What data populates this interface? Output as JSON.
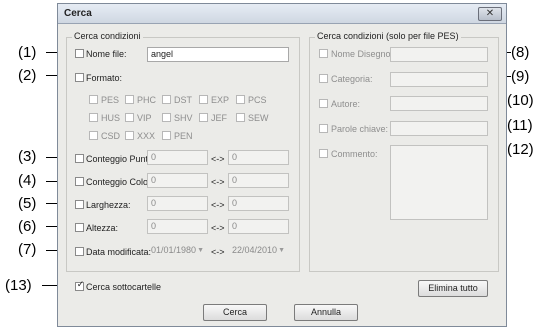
{
  "window": {
    "title": "Cerca",
    "close_icon": "close-icon"
  },
  "left": {
    "group_title": "Cerca condizioni",
    "nome_file": {
      "label": "Nome file:",
      "value": "angel"
    },
    "formato": {
      "label": "Formato:",
      "formats": [
        "PES",
        "PHC",
        "DST",
        "EXP",
        "PCS",
        "HUS",
        "VIP",
        "SHV",
        "JEF",
        "SEW",
        "CSD",
        "XXX",
        "PEN"
      ]
    },
    "conteggio_punti": {
      "label": "Conteggio Punti:",
      "from": "0",
      "to": "0"
    },
    "conteggio_colori": {
      "label": "Conteggio Colori:",
      "from": "0",
      "to": "0"
    },
    "larghezza": {
      "label": "Larghezza:",
      "from": "0",
      "to": "0"
    },
    "altezza": {
      "label": "Altezza:",
      "from": "0",
      "to": "0"
    },
    "data_modificata": {
      "label": "Data modificata:",
      "from": "01/01/1980",
      "to": "22/04/2010"
    },
    "range_sep": "<->"
  },
  "right": {
    "group_title": "Cerca condizioni (solo per file PES)",
    "nome_disegno": "Nome Disegno",
    "categoria": "Categoria:",
    "autore": "Autore:",
    "parole_chiave": "Parole chiave:",
    "commento": "Commento:"
  },
  "cerca_sottocartelle": "Cerca sottocartelle",
  "buttons": {
    "elimina": "Elimina tutto",
    "cerca": "Cerca",
    "annulla": "Annulla"
  },
  "callouts": [
    "(1)",
    "(2)",
    "(3)",
    "(4)",
    "(5)",
    "(6)",
    "(7)",
    "(8)",
    "(9)",
    "(10)",
    "(11)",
    "(12)",
    "(13)"
  ]
}
